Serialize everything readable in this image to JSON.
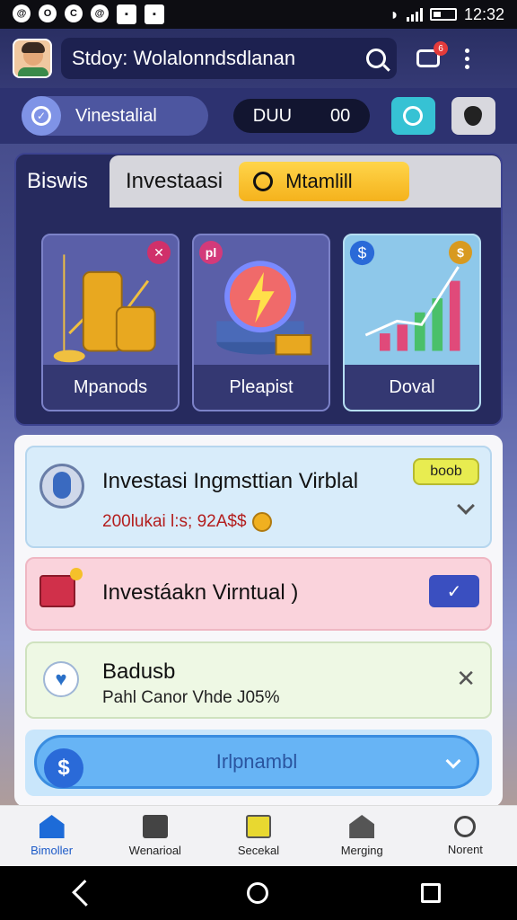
{
  "status_bar": {
    "time": "12:32"
  },
  "header": {
    "search_text": "Stdoy: Wolalonndsdlanan",
    "notification_count": "6"
  },
  "toolbar": {
    "pill_label": "Vinestalial",
    "counter_left": "DUU",
    "counter_right": "00"
  },
  "panel": {
    "tab_active": "Biswis",
    "tab_second": "Investaasi",
    "tab_highlight": "Mtamlill",
    "cards": [
      {
        "label": "Mpanods",
        "badge": "✕",
        "badge_color": "#d0306a"
      },
      {
        "label": "Pleapist",
        "badge": "pl",
        "badge_color": "#d33a7a"
      },
      {
        "label": "Doval",
        "badge": "$",
        "badge_color": "#d89a20"
      }
    ]
  },
  "list": {
    "row1": {
      "title": "Investasi Ingmsttian Virblal",
      "subtitle": "200lukai l:s; 92A$$",
      "tag": "boob"
    },
    "row2": {
      "title": "Investáakn Virntual )",
      "button": "✓"
    },
    "row3": {
      "title": "Badusb",
      "subtitle": "Pahl Canor Vhde J05%",
      "close": "✕"
    },
    "row4": {
      "button_label": "Irlpnambl"
    }
  },
  "bottom_nav": [
    {
      "label": "Bimoller"
    },
    {
      "label": "Wenarioal"
    },
    {
      "label": "Secekal"
    },
    {
      "label": "Merging"
    },
    {
      "label": "Norent"
    }
  ],
  "colors": {
    "accent": "#1d5bc8",
    "highlight": "#f5b21c",
    "brand_dark": "#262a5e"
  }
}
